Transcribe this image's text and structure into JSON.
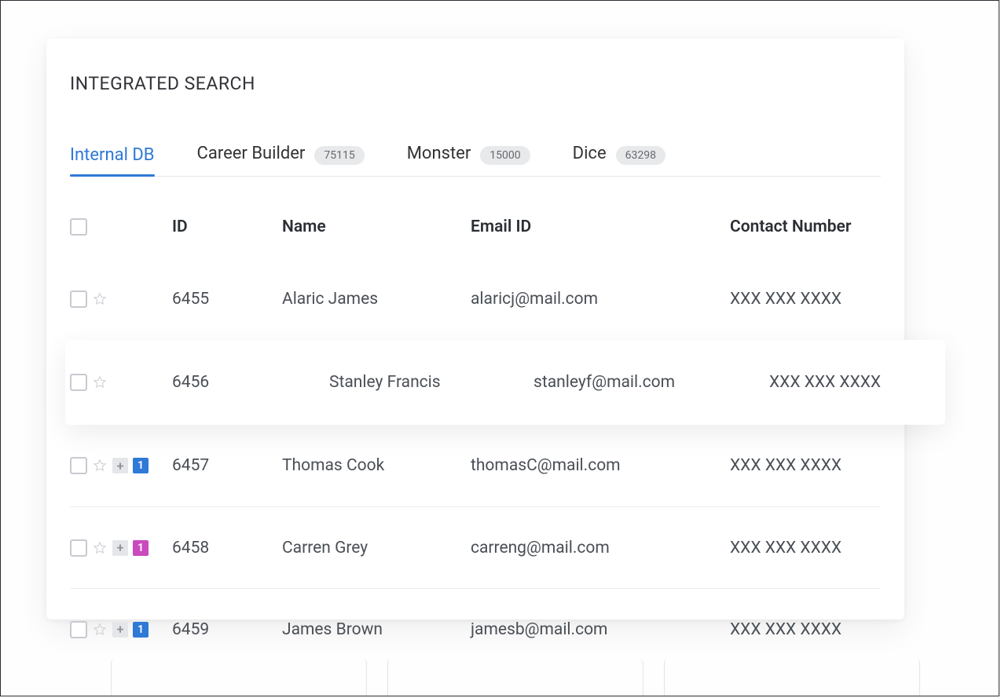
{
  "page": {
    "title": "INTEGRATED SEARCH"
  },
  "tabs": [
    {
      "label": "Internal DB",
      "count": null,
      "active": true
    },
    {
      "label": "Career Builder",
      "count": "75115",
      "active": false
    },
    {
      "label": "Monster",
      "count": "15000",
      "active": false
    },
    {
      "label": "Dice",
      "count": "63298",
      "active": false
    }
  ],
  "table": {
    "headers": {
      "id": "ID",
      "name": "Name",
      "email": "Email ID",
      "contact": "Contact Number"
    },
    "rows": [
      {
        "id": "6455",
        "name": "Alaric James",
        "email": "alaricj@mail.com",
        "contact": "XXX XXX XXXX",
        "tag": null,
        "floating": false
      },
      {
        "id": "6456",
        "name": "Stanley Francis",
        "email": "stanleyf@mail.com",
        "contact": "XXX XXX XXXX",
        "tag": null,
        "floating": true
      },
      {
        "id": "6457",
        "name": "Thomas Cook",
        "email": "thomasC@mail.com",
        "contact": "XXX XXX XXXX",
        "tag": {
          "value": "1",
          "color": "blue"
        },
        "floating": false
      },
      {
        "id": "6458",
        "name": "Carren Grey",
        "email": "carreng@mail.com",
        "contact": "XXX XXX XXXX",
        "tag": {
          "value": "1",
          "color": "pink"
        },
        "floating": false
      },
      {
        "id": "6459",
        "name": "James Brown",
        "email": "jamesb@mail.com",
        "contact": "XXX XXX XXXX",
        "tag": {
          "value": "1",
          "color": "blue"
        },
        "floating": false
      }
    ]
  },
  "icons": {
    "plus": "+"
  },
  "colors": {
    "accent": "#2f79d7",
    "badgeBg": "#e8e9eb",
    "pink": "#c94bbd"
  }
}
